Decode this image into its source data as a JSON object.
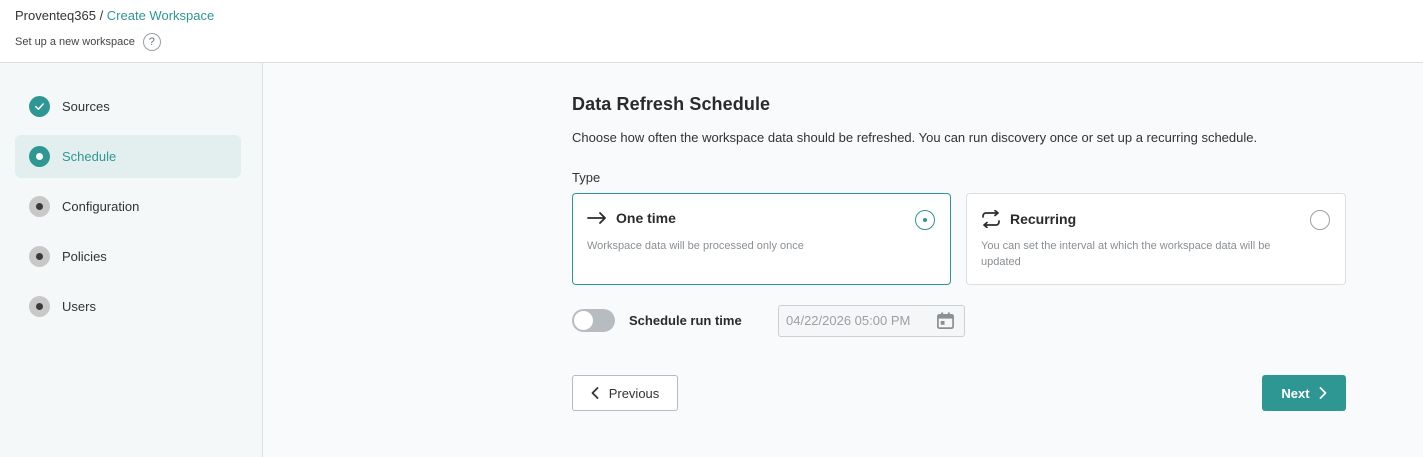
{
  "header": {
    "breadcrumb_root": "Proventeq365",
    "breadcrumb_sep": " / ",
    "breadcrumb_current": "Create Workspace",
    "subtitle": "Set up a new workspace",
    "help_icon": "?"
  },
  "sidebar": {
    "steps": [
      {
        "label": "Sources",
        "status": "done",
        "icon": "check-icon"
      },
      {
        "label": "Schedule",
        "status": "current",
        "icon": "dot-icon"
      },
      {
        "label": "Configuration",
        "status": "pending",
        "icon": "dot-icon"
      },
      {
        "label": "Policies",
        "status": "pending",
        "icon": "dot-icon"
      },
      {
        "label": "Users",
        "status": "pending",
        "icon": "dot-icon"
      }
    ]
  },
  "main": {
    "title": "Data Refresh Schedule",
    "description": "Choose how often the workspace data should be refreshed. You can run discovery once or set up a recurring schedule.",
    "type_label": "Type",
    "options": [
      {
        "title": "One time",
        "text": "Workspace data will be processed only once",
        "selected": true,
        "icon": "arrow-right-icon"
      },
      {
        "title": "Recurring",
        "text": "You can set the interval at which the workspace data will be updated",
        "selected": false,
        "icon": "repeat-icon"
      }
    ],
    "schedule_toggle_label": "Schedule run time",
    "schedule_toggle_on": false,
    "schedule_date_value": "04/22/2026 05:00 PM",
    "previous_label": "Previous",
    "next_label": "Next"
  },
  "colors": {
    "accent": "#2f9793",
    "active_step_bg": "#e3efef",
    "pending_dot": "#c8c8c8"
  }
}
